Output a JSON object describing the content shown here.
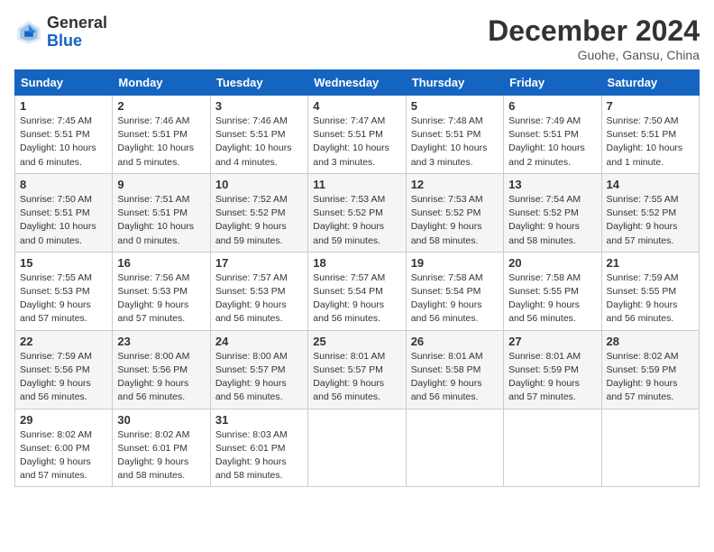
{
  "header": {
    "logo_line1": "General",
    "logo_line2": "Blue",
    "month": "December 2024",
    "location": "Guohe, Gansu, China"
  },
  "weekdays": [
    "Sunday",
    "Monday",
    "Tuesday",
    "Wednesday",
    "Thursday",
    "Friday",
    "Saturday"
  ],
  "weeks": [
    [
      {
        "day": "1",
        "sunrise": "7:45 AM",
        "sunset": "5:51 PM",
        "daylight": "10 hours and 6 minutes."
      },
      {
        "day": "2",
        "sunrise": "7:46 AM",
        "sunset": "5:51 PM",
        "daylight": "10 hours and 5 minutes."
      },
      {
        "day": "3",
        "sunrise": "7:46 AM",
        "sunset": "5:51 PM",
        "daylight": "10 hours and 4 minutes."
      },
      {
        "day": "4",
        "sunrise": "7:47 AM",
        "sunset": "5:51 PM",
        "daylight": "10 hours and 3 minutes."
      },
      {
        "day": "5",
        "sunrise": "7:48 AM",
        "sunset": "5:51 PM",
        "daylight": "10 hours and 3 minutes."
      },
      {
        "day": "6",
        "sunrise": "7:49 AM",
        "sunset": "5:51 PM",
        "daylight": "10 hours and 2 minutes."
      },
      {
        "day": "7",
        "sunrise": "7:50 AM",
        "sunset": "5:51 PM",
        "daylight": "10 hours and 1 minute."
      }
    ],
    [
      {
        "day": "8",
        "sunrise": "7:50 AM",
        "sunset": "5:51 PM",
        "daylight": "10 hours and 0 minutes."
      },
      {
        "day": "9",
        "sunrise": "7:51 AM",
        "sunset": "5:51 PM",
        "daylight": "10 hours and 0 minutes."
      },
      {
        "day": "10",
        "sunrise": "7:52 AM",
        "sunset": "5:52 PM",
        "daylight": "9 hours and 59 minutes."
      },
      {
        "day": "11",
        "sunrise": "7:53 AM",
        "sunset": "5:52 PM",
        "daylight": "9 hours and 59 minutes."
      },
      {
        "day": "12",
        "sunrise": "7:53 AM",
        "sunset": "5:52 PM",
        "daylight": "9 hours and 58 minutes."
      },
      {
        "day": "13",
        "sunrise": "7:54 AM",
        "sunset": "5:52 PM",
        "daylight": "9 hours and 58 minutes."
      },
      {
        "day": "14",
        "sunrise": "7:55 AM",
        "sunset": "5:52 PM",
        "daylight": "9 hours and 57 minutes."
      }
    ],
    [
      {
        "day": "15",
        "sunrise": "7:55 AM",
        "sunset": "5:53 PM",
        "daylight": "9 hours and 57 minutes."
      },
      {
        "day": "16",
        "sunrise": "7:56 AM",
        "sunset": "5:53 PM",
        "daylight": "9 hours and 57 minutes."
      },
      {
        "day": "17",
        "sunrise": "7:57 AM",
        "sunset": "5:53 PM",
        "daylight": "9 hours and 56 minutes."
      },
      {
        "day": "18",
        "sunrise": "7:57 AM",
        "sunset": "5:54 PM",
        "daylight": "9 hours and 56 minutes."
      },
      {
        "day": "19",
        "sunrise": "7:58 AM",
        "sunset": "5:54 PM",
        "daylight": "9 hours and 56 minutes."
      },
      {
        "day": "20",
        "sunrise": "7:58 AM",
        "sunset": "5:55 PM",
        "daylight": "9 hours and 56 minutes."
      },
      {
        "day": "21",
        "sunrise": "7:59 AM",
        "sunset": "5:55 PM",
        "daylight": "9 hours and 56 minutes."
      }
    ],
    [
      {
        "day": "22",
        "sunrise": "7:59 AM",
        "sunset": "5:56 PM",
        "daylight": "9 hours and 56 minutes."
      },
      {
        "day": "23",
        "sunrise": "8:00 AM",
        "sunset": "5:56 PM",
        "daylight": "9 hours and 56 minutes."
      },
      {
        "day": "24",
        "sunrise": "8:00 AM",
        "sunset": "5:57 PM",
        "daylight": "9 hours and 56 minutes."
      },
      {
        "day": "25",
        "sunrise": "8:01 AM",
        "sunset": "5:57 PM",
        "daylight": "9 hours and 56 minutes."
      },
      {
        "day": "26",
        "sunrise": "8:01 AM",
        "sunset": "5:58 PM",
        "daylight": "9 hours and 56 minutes."
      },
      {
        "day": "27",
        "sunrise": "8:01 AM",
        "sunset": "5:59 PM",
        "daylight": "9 hours and 57 minutes."
      },
      {
        "day": "28",
        "sunrise": "8:02 AM",
        "sunset": "5:59 PM",
        "daylight": "9 hours and 57 minutes."
      }
    ],
    [
      {
        "day": "29",
        "sunrise": "8:02 AM",
        "sunset": "6:00 PM",
        "daylight": "9 hours and 57 minutes."
      },
      {
        "day": "30",
        "sunrise": "8:02 AM",
        "sunset": "6:01 PM",
        "daylight": "9 hours and 58 minutes."
      },
      {
        "day": "31",
        "sunrise": "8:03 AM",
        "sunset": "6:01 PM",
        "daylight": "9 hours and 58 minutes."
      },
      null,
      null,
      null,
      null
    ]
  ]
}
